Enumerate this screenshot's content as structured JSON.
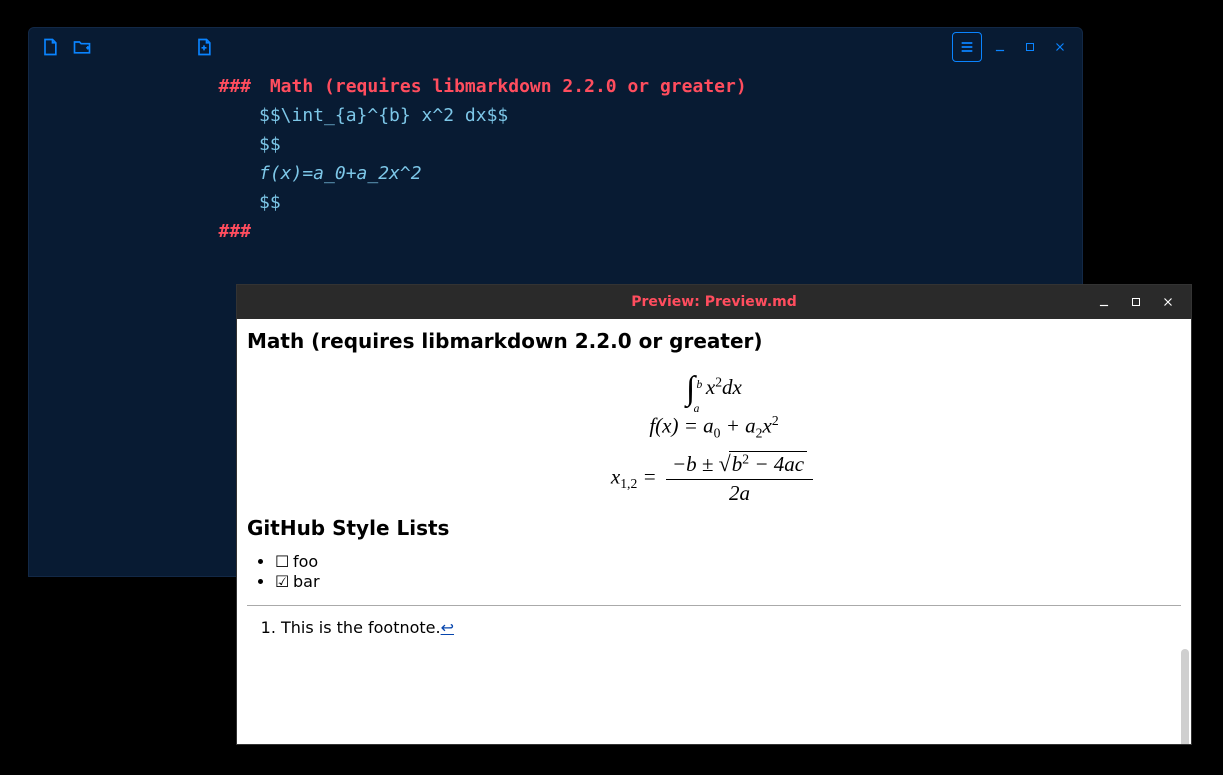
{
  "editor": {
    "toolbar": {
      "icons": [
        "new-file-icon",
        "new-folder-icon",
        "open-file-icon"
      ]
    },
    "heading_marker": "###",
    "lines": [
      {
        "gutter": "###",
        "class": "heading-text",
        "text": " Math (requires libmarkdown 2.2.0 or greater)"
      },
      {
        "gutter": "",
        "class": "code",
        "text": ""
      },
      {
        "gutter": "",
        "class": "code",
        "text": "$$\\int_{a}^{b} x^2 dx$$"
      },
      {
        "gutter": "",
        "class": "code",
        "text": ""
      },
      {
        "gutter": "",
        "class": "code",
        "text": "$$"
      },
      {
        "gutter": "",
        "class": "italic",
        "text": "f(x)=a_0+a_2x^2"
      },
      {
        "gutter": "",
        "class": "code",
        "text": "$$"
      },
      {
        "gutter": "",
        "class": "code",
        "text": ""
      },
      {
        "gutter": "",
        "class": "code",
        "text": ""
      },
      {
        "gutter": "",
        "class": "code",
        "text": ""
      },
      {
        "gutter": "###",
        "class": "heading-text",
        "text": ""
      }
    ]
  },
  "preview": {
    "title": "Preview: Preview.md",
    "h_math": "Math (requires libmarkdown 2.2.0 or greater)",
    "math1": {
      "int_lb": "a",
      "int_ub": "b",
      "body": "x",
      "exp": "2",
      "dx": "dx"
    },
    "math2": {
      "lhs": "f(x)",
      "eq": " = ",
      "a0": "a",
      "s0": "0",
      "plus": " + ",
      "a2": "a",
      "s2": "2",
      "x": "x",
      "e2": "2"
    },
    "math3": {
      "x": "x",
      "sub": "1,2",
      "eq": " = ",
      "num_pre": "−b ± ",
      "rad": "b",
      "rad_e": "2",
      "rad_post": " − 4ac",
      "den": "2a"
    },
    "h_lists": "GitHub Style Lists",
    "list": [
      {
        "checked": false,
        "label": "foo"
      },
      {
        "checked": true,
        "label": "bar"
      }
    ],
    "footnote": {
      "num": "1",
      "text": "This is the footnote.",
      "back": "↩"
    }
  }
}
